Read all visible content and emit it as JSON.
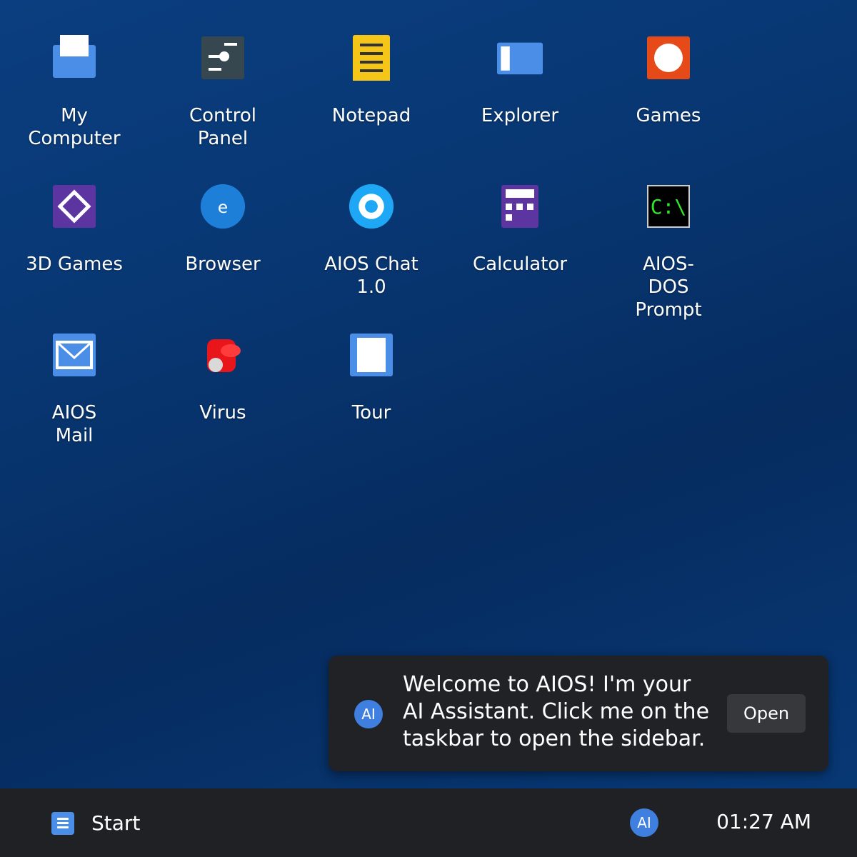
{
  "desktop": {
    "icons": [
      {
        "label": "My Computer",
        "icon": "folder-icon",
        "color": "#4a8ee8"
      },
      {
        "label": "Control Panel",
        "icon": "settings-sliders-icon",
        "color": "#37474f"
      },
      {
        "label": "Notepad",
        "icon": "notepad-icon",
        "color": "#f5c518"
      },
      {
        "label": "Explorer",
        "icon": "window-panel-icon",
        "color": "#4a8ee8"
      },
      {
        "label": "Games",
        "icon": "record-dot-icon",
        "color": "#e64a19"
      },
      {
        "label": "3D Games",
        "icon": "diamond-icon",
        "color": "#5c35a0"
      },
      {
        "label": "Browser",
        "icon": "browser-e-icon",
        "color": "#1e7fd8"
      },
      {
        "label": "AIOS Chat 1.0",
        "icon": "chat-ring-icon",
        "color": "#1ea7f5"
      },
      {
        "label": "Calculator",
        "icon": "calculator-icon",
        "color": "#5c35a0"
      },
      {
        "label": "AIOS-DOS Prompt",
        "icon": "terminal-icon",
        "color": "#000000"
      },
      {
        "label": "AIOS Mail",
        "icon": "mail-icon",
        "color": "#4a8ee8"
      },
      {
        "label": "Virus",
        "icon": "virus-icon",
        "color": "#e8151b"
      },
      {
        "label": "Tour",
        "icon": "document-icon",
        "color": "#4a8ee8"
      }
    ],
    "terminal_prompt": "C:\\",
    "browser_glyph": "e"
  },
  "notification": {
    "badge": "AI",
    "message": "Welcome to AIOS! I'm your AI Assistant. Click me on the taskbar to open the sidebar.",
    "button_label": "Open"
  },
  "taskbar": {
    "start_label": "Start",
    "ai_badge": "AI",
    "clock": "01:27 AM"
  }
}
